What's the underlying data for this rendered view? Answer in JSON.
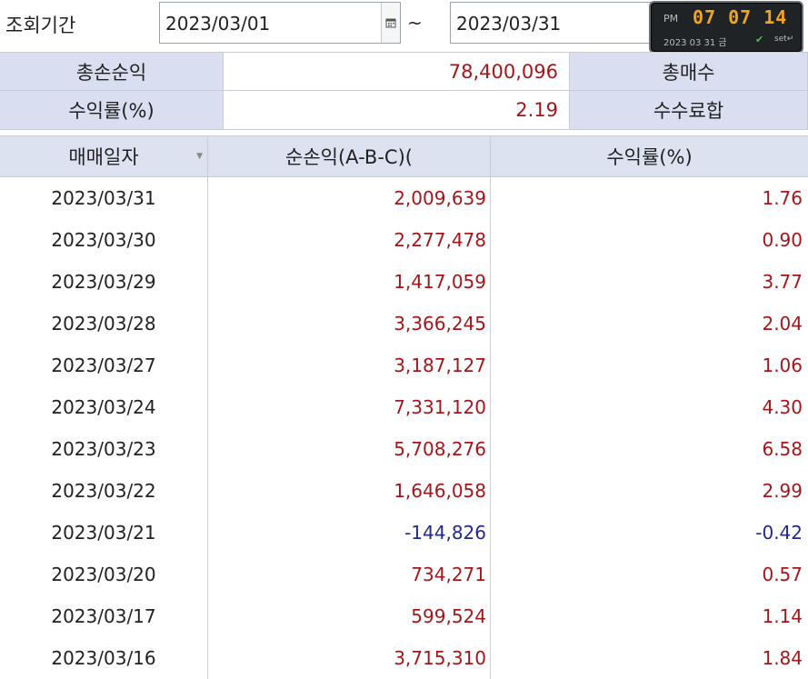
{
  "filter": {
    "label": "조회기간",
    "date_from": "2023/03/01",
    "separator": "~",
    "date_to": "2023/03/31"
  },
  "clock": {
    "ampm": "PM",
    "time": "07 07 14",
    "date": "2023 03 31 금",
    "set_label": "set"
  },
  "summary": {
    "total_pnl_label": "총손순익",
    "total_pnl_value": "78,400,096",
    "total_trades_label": "총매수",
    "return_label": "수익률(%)",
    "return_value": "2.19",
    "fees_label": "수수료합"
  },
  "table": {
    "columns": [
      "매매일자",
      "순손익(A-B-C)(",
      "수익률(%)"
    ],
    "rows": [
      {
        "date": "2023/03/31",
        "pnl": "2,009,639",
        "rate": "1.76",
        "sign": "pos"
      },
      {
        "date": "2023/03/30",
        "pnl": "2,277,478",
        "rate": "0.90",
        "sign": "pos"
      },
      {
        "date": "2023/03/29",
        "pnl": "1,417,059",
        "rate": "3.77",
        "sign": "pos"
      },
      {
        "date": "2023/03/28",
        "pnl": "3,366,245",
        "rate": "2.04",
        "sign": "pos"
      },
      {
        "date": "2023/03/27",
        "pnl": "3,187,127",
        "rate": "1.06",
        "sign": "pos"
      },
      {
        "date": "2023/03/24",
        "pnl": "7,331,120",
        "rate": "4.30",
        "sign": "pos"
      },
      {
        "date": "2023/03/23",
        "pnl": "5,708,276",
        "rate": "6.58",
        "sign": "pos"
      },
      {
        "date": "2023/03/22",
        "pnl": "1,646,058",
        "rate": "2.99",
        "sign": "pos"
      },
      {
        "date": "2023/03/21",
        "pnl": "-144,826",
        "rate": "-0.42",
        "sign": "neg"
      },
      {
        "date": "2023/03/20",
        "pnl": "734,271",
        "rate": "0.57",
        "sign": "pos"
      },
      {
        "date": "2023/03/17",
        "pnl": "599,524",
        "rate": "1.14",
        "sign": "pos"
      },
      {
        "date": "2023/03/16",
        "pnl": "3,715,310",
        "rate": "1.84",
        "sign": "pos"
      }
    ]
  },
  "colors": {
    "positive": "#a4161a",
    "negative": "#1f2a8c",
    "header_bg": "#dde2f0"
  }
}
